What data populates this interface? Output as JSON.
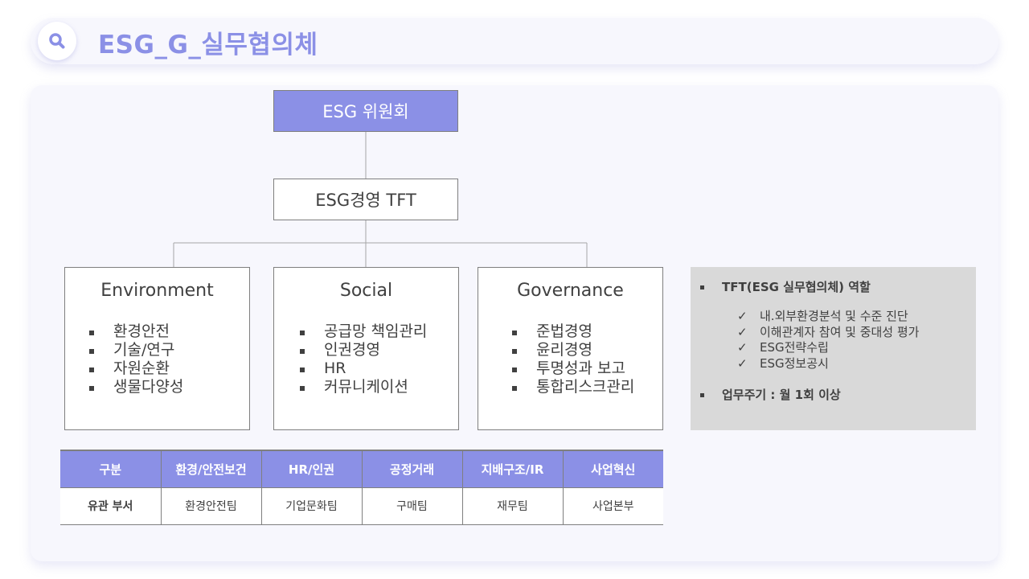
{
  "header": {
    "title": "ESG_G_실무협의체",
    "icon": "search-icon"
  },
  "colors": {
    "accent": "#8b90e6",
    "panel_bg": "#f7f7fd",
    "role_panel_bg": "#d9d9d9",
    "text": "#404040",
    "border": "#7f7f7f"
  },
  "org_chart": {
    "committee": "ESG 위원회",
    "tft": "ESG경영 TFT",
    "pillars": [
      {
        "title": "Environment",
        "items": [
          "환경안전",
          "기술/연구",
          "자원순환",
          "생물다양성"
        ]
      },
      {
        "title": "Social",
        "items": [
          "공급망 책임관리",
          "인권경영",
          "HR",
          "커뮤니케이션"
        ]
      },
      {
        "title": "Governance",
        "items": [
          "준법경영",
          "윤리경영",
          "투명성과 보고",
          "통합리스크관리"
        ]
      }
    ]
  },
  "tft_role": {
    "heading": "TFT(ESG 실무협의체) 역할",
    "check_glyph": "✓",
    "items": [
      "내.외부환경분석 및 수준 진단",
      "이해관계자 참여 및 중대성 평가",
      "ESG전략수립",
      "ESG정보공시"
    ],
    "cycle": "업무주기 : 월 1회 이상"
  },
  "dept_table": {
    "headers": [
      "구분",
      "환경/안전보건",
      "HR/인권",
      "공정거래",
      "지배구조/IR",
      "사업혁신"
    ],
    "row": [
      "유관 부서",
      "환경안전팀",
      "기업문화팀",
      "구매팀",
      "재무팀",
      "사업본부"
    ]
  }
}
